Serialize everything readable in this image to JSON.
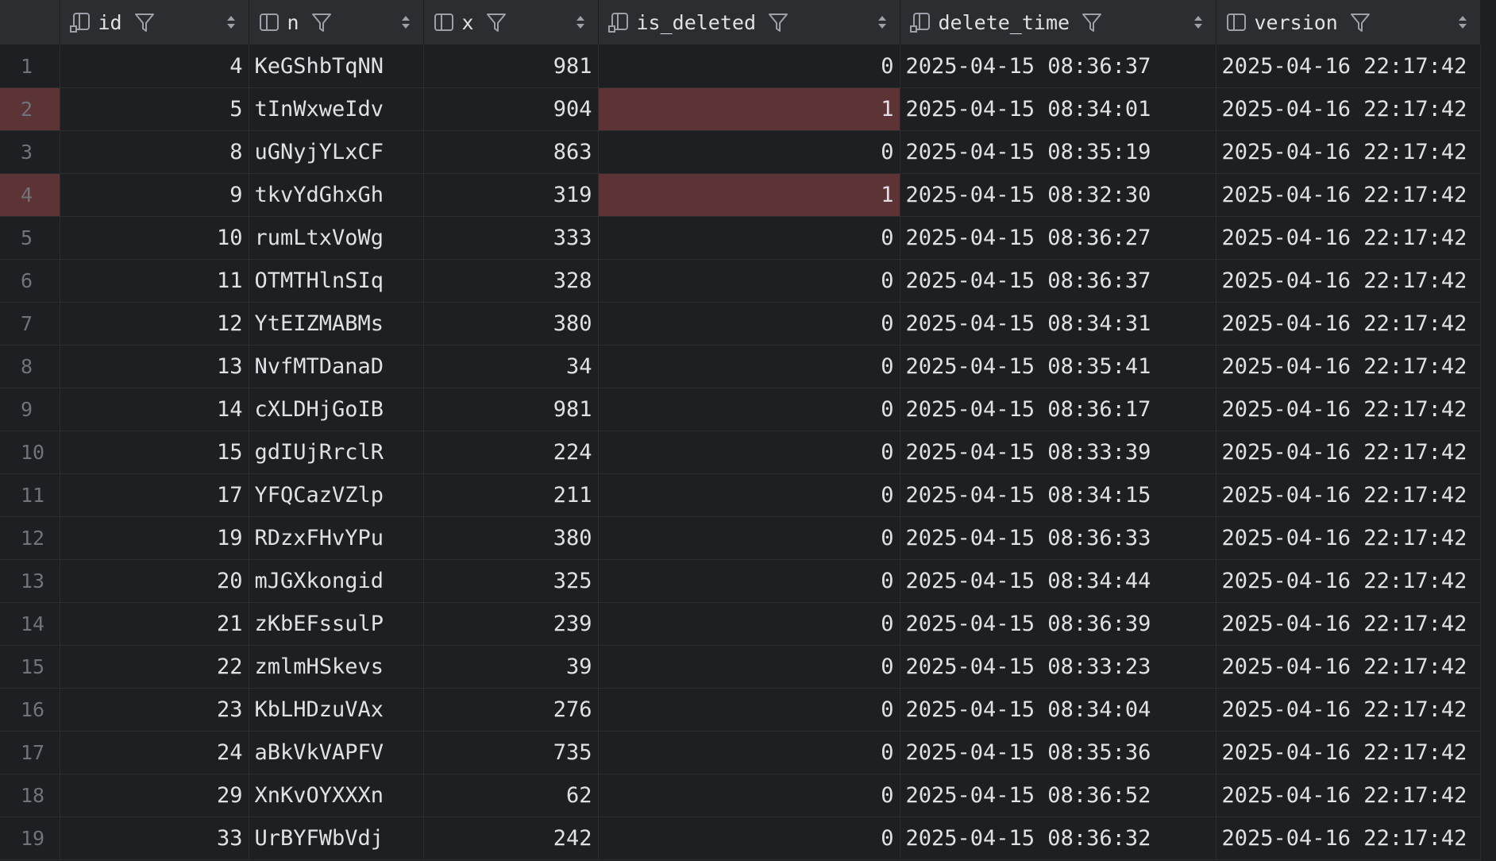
{
  "columns": [
    {
      "name": "id",
      "icon": "key-column-icon"
    },
    {
      "name": "n",
      "icon": "column-icon"
    },
    {
      "name": "x",
      "icon": "column-icon"
    },
    {
      "name": "is_deleted",
      "icon": "key-column-icon"
    },
    {
      "name": "delete_time",
      "icon": "key-column-icon"
    },
    {
      "name": "version",
      "icon": "column-icon"
    }
  ],
  "colors": {
    "background": "#1e1f22",
    "header": "#2b2d30",
    "highlight": "#5c3436",
    "text": "#dfe1e5",
    "row_number": "#6f737a"
  },
  "rows": [
    {
      "num": "1",
      "id": "4",
      "n": "KeGShbTqNN",
      "x": "981",
      "is_deleted": "0",
      "delete_time": "2025-04-15 08:36:37",
      "version": "2025-04-16 22:17:42"
    },
    {
      "num": "2",
      "id": "5",
      "n": "tInWxweIdv",
      "x": "904",
      "is_deleted": "1",
      "delete_time": "2025-04-15 08:34:01",
      "version": "2025-04-16 22:17:42"
    },
    {
      "num": "3",
      "id": "8",
      "n": "uGNyjYLxCF",
      "x": "863",
      "is_deleted": "0",
      "delete_time": "2025-04-15 08:35:19",
      "version": "2025-04-16 22:17:42"
    },
    {
      "num": "4",
      "id": "9",
      "n": "tkvYdGhxGh",
      "x": "319",
      "is_deleted": "1",
      "delete_time": "2025-04-15 08:32:30",
      "version": "2025-04-16 22:17:42"
    },
    {
      "num": "5",
      "id": "10",
      "n": "rumLtxVoWg",
      "x": "333",
      "is_deleted": "0",
      "delete_time": "2025-04-15 08:36:27",
      "version": "2025-04-16 22:17:42"
    },
    {
      "num": "6",
      "id": "11",
      "n": "OTMTHlnSIq",
      "x": "328",
      "is_deleted": "0",
      "delete_time": "2025-04-15 08:36:37",
      "version": "2025-04-16 22:17:42"
    },
    {
      "num": "7",
      "id": "12",
      "n": "YtEIZMABMs",
      "x": "380",
      "is_deleted": "0",
      "delete_time": "2025-04-15 08:34:31",
      "version": "2025-04-16 22:17:42"
    },
    {
      "num": "8",
      "id": "13",
      "n": "NvfMTDanaD",
      "x": "34",
      "is_deleted": "0",
      "delete_time": "2025-04-15 08:35:41",
      "version": "2025-04-16 22:17:42"
    },
    {
      "num": "9",
      "id": "14",
      "n": "cXLDHjGoIB",
      "x": "981",
      "is_deleted": "0",
      "delete_time": "2025-04-15 08:36:17",
      "version": "2025-04-16 22:17:42"
    },
    {
      "num": "10",
      "id": "15",
      "n": "gdIUjRrclR",
      "x": "224",
      "is_deleted": "0",
      "delete_time": "2025-04-15 08:33:39",
      "version": "2025-04-16 22:17:42"
    },
    {
      "num": "11",
      "id": "17",
      "n": "YFQCazVZlp",
      "x": "211",
      "is_deleted": "0",
      "delete_time": "2025-04-15 08:34:15",
      "version": "2025-04-16 22:17:42"
    },
    {
      "num": "12",
      "id": "19",
      "n": "RDzxFHvYPu",
      "x": "380",
      "is_deleted": "0",
      "delete_time": "2025-04-15 08:36:33",
      "version": "2025-04-16 22:17:42"
    },
    {
      "num": "13",
      "id": "20",
      "n": "mJGXkongid",
      "x": "325",
      "is_deleted": "0",
      "delete_time": "2025-04-15 08:34:44",
      "version": "2025-04-16 22:17:42"
    },
    {
      "num": "14",
      "id": "21",
      "n": "zKbEFssulP",
      "x": "239",
      "is_deleted": "0",
      "delete_time": "2025-04-15 08:36:39",
      "version": "2025-04-16 22:17:42"
    },
    {
      "num": "15",
      "id": "22",
      "n": "zmlmHSkevs",
      "x": "39",
      "is_deleted": "0",
      "delete_time": "2025-04-15 08:33:23",
      "version": "2025-04-16 22:17:42"
    },
    {
      "num": "16",
      "id": "23",
      "n": "KbLHDzuVAx",
      "x": "276",
      "is_deleted": "0",
      "delete_time": "2025-04-15 08:34:04",
      "version": "2025-04-16 22:17:42"
    },
    {
      "num": "17",
      "id": "24",
      "n": "aBkVkVAPFV",
      "x": "735",
      "is_deleted": "0",
      "delete_time": "2025-04-15 08:35:36",
      "version": "2025-04-16 22:17:42"
    },
    {
      "num": "18",
      "id": "29",
      "n": "XnKvOYXXXn",
      "x": "62",
      "is_deleted": "0",
      "delete_time": "2025-04-15 08:36:52",
      "version": "2025-04-16 22:17:42"
    },
    {
      "num": "19",
      "id": "33",
      "n": "UrBYFWbVdj",
      "x": "242",
      "is_deleted": "0",
      "delete_time": "2025-04-15 08:36:32",
      "version": "2025-04-16 22:17:42"
    }
  ]
}
